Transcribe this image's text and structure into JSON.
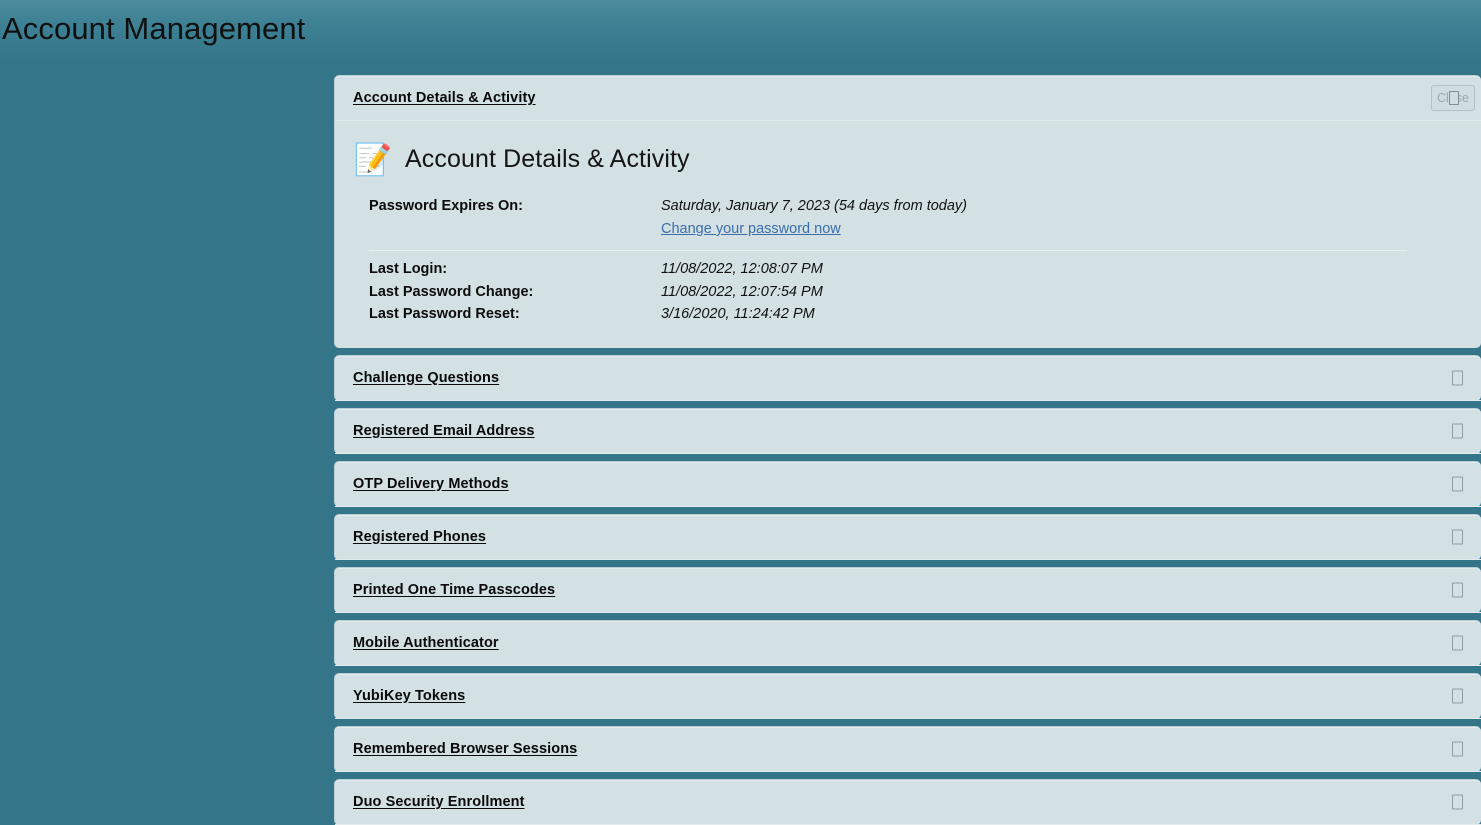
{
  "page": {
    "title": "Account Management"
  },
  "close_button": {
    "label": "Close",
    "icon": "missing-glyph-box",
    "disabled": true
  },
  "colors": {
    "page_background": "#35758a",
    "title_gradient_top": "#4e8b9c",
    "panel_background": "#d3e0e4",
    "link": "#3c6ea8",
    "text": "#111111"
  },
  "accordion": {
    "expanded_panel": {
      "header_label": "Account Details & Activity",
      "heading": "Account Details & Activity",
      "heading_icon": "memo-icon",
      "details_group_one": [
        {
          "label": "Password Expires On:",
          "value": "Saturday, January 7, 2023 (54 days from today)"
        }
      ],
      "link": "Change your password now",
      "details_group_two": [
        {
          "label": "Last Login:",
          "value": "11/08/2022, 12:08:07 PM"
        },
        {
          "label": "Last Password Change:",
          "value": "11/08/2022, 12:07:54 PM"
        },
        {
          "label": "Last Password Reset:",
          "value": "3/16/2020, 11:24:42 PM"
        }
      ]
    },
    "collapsed_panels": [
      {
        "label": "Challenge Questions",
        "icon": "expand-toggle-icon"
      },
      {
        "label": "Registered Email Address",
        "icon": "expand-toggle-icon"
      },
      {
        "label": "OTP Delivery Methods",
        "icon": "expand-toggle-icon"
      },
      {
        "label": "Registered Phones",
        "icon": "expand-toggle-icon"
      },
      {
        "label": "Printed One Time Passcodes",
        "icon": "expand-toggle-icon"
      },
      {
        "label": "Mobile Authenticator",
        "icon": "expand-toggle-icon"
      },
      {
        "label": "YubiKey Tokens",
        "icon": "expand-toggle-icon"
      },
      {
        "label": "Remembered Browser Sessions",
        "icon": "expand-toggle-icon"
      },
      {
        "label": "Duo Security Enrollment",
        "icon": "expand-toggle-icon"
      }
    ]
  }
}
